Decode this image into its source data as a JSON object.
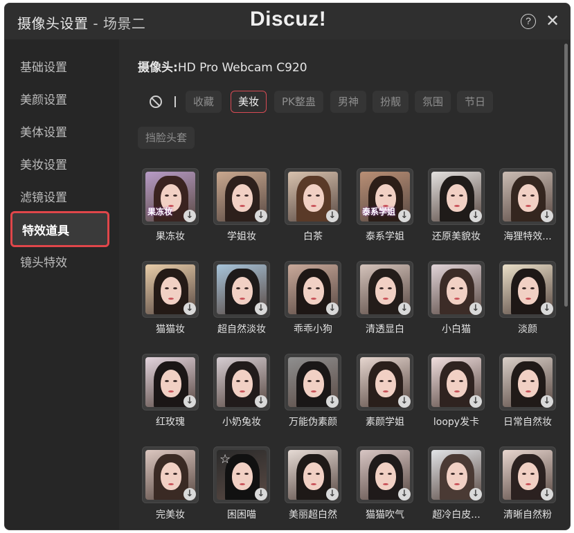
{
  "window": {
    "title": "摄像头设置",
    "scene": " - 场景二",
    "watermark": "Discuz!",
    "help_icon": "?",
    "close_icon": "✕"
  },
  "sidebar": {
    "items": [
      {
        "label": "基础设置"
      },
      {
        "label": "美颜设置"
      },
      {
        "label": "美体设置"
      },
      {
        "label": "美妆设置"
      },
      {
        "label": "滤镜设置"
      },
      {
        "label": "特效道具",
        "active": true
      },
      {
        "label": "镜头特效"
      }
    ]
  },
  "camera": {
    "label": "摄像头:",
    "name": "HD Pro Webcam C920"
  },
  "tabs": [
    {
      "label": "收藏"
    },
    {
      "label": "美妆",
      "active": true
    },
    {
      "label": "PK整蛊"
    },
    {
      "label": "男神"
    },
    {
      "label": "扮靓"
    },
    {
      "label": "氛围"
    },
    {
      "label": "节日"
    },
    {
      "label": "挡脸头套"
    }
  ],
  "colors": {
    "accent": "#e0464a",
    "panel": "#2b2b2b",
    "sidebar": "#262626"
  },
  "effects": [
    {
      "name": "果冻妆",
      "badge": "果冻妆",
      "bg": "#b89cc7",
      "hair": "#3a2320"
    },
    {
      "name": "学姐妆",
      "badge": "",
      "bg": "#c9a88f",
      "hair": "#2d201c"
    },
    {
      "name": "白茶",
      "badge": "",
      "bg": "#d8c2ae",
      "hair": "#5a3a28"
    },
    {
      "name": "泰系学姐",
      "badge": "泰系学姐",
      "bg": "#b98f75",
      "hair": "#2c1e18"
    },
    {
      "name": "还原美貌妆",
      "badge": "",
      "bg": "#e4e2e0",
      "hair": "#1f1b19"
    },
    {
      "name": "海狸特效...",
      "badge": "",
      "bg": "#cbbdb4",
      "hair": "#34261f"
    },
    {
      "name": "猫猫妆",
      "badge": "",
      "bg": "#e8cda9",
      "hair": "#241a16"
    },
    {
      "name": "超自然淡妆",
      "badge": "",
      "bg": "#a7c4da",
      "hair": "#1d1a1a"
    },
    {
      "name": "乖乖小狗",
      "badge": "",
      "bg": "#c9a99a",
      "hair": "#1e1715"
    },
    {
      "name": "清透显白",
      "badge": "",
      "bg": "#d4c3bb",
      "hair": "#241d1a"
    },
    {
      "name": "小白猫",
      "badge": "",
      "bg": "#e1d4d8",
      "hair": "#3c2c27"
    },
    {
      "name": "淡颜",
      "badge": "",
      "bg": "#eadfc8",
      "hair": "#1e1816"
    },
    {
      "name": "红玫瑰",
      "badge": "",
      "bg": "#e3d4dd",
      "hair": "#1b1616"
    },
    {
      "name": "小奶兔妆",
      "badge": "",
      "bg": "#d6cdd2",
      "hair": "#211b1b"
    },
    {
      "name": "万能伪素颜",
      "badge": "",
      "bg": "#8f8f8f",
      "hair": "#1a1717"
    },
    {
      "name": "素颜学姐",
      "badge": "",
      "bg": "#e6d6cf",
      "hair": "#2a1f1b"
    },
    {
      "name": "loopy发卡",
      "badge": "",
      "bg": "#f0dede",
      "hair": "#2f2320"
    },
    {
      "name": "日常自然妆",
      "badge": "",
      "bg": "#d9cfc8",
      "hair": "#201a18"
    },
    {
      "name": "完美妆",
      "badge": "",
      "bg": "#dcc7c0",
      "hair": "#3a2a24"
    },
    {
      "name": "困困喵",
      "badge": "",
      "bg": "#2a2a2a",
      "hair": "#111111",
      "star": true
    },
    {
      "name": "美丽超白然",
      "badge": "",
      "bg": "#e6dbd5",
      "hair": "#1e1917"
    },
    {
      "name": "猫猫吹气",
      "badge": "",
      "bg": "#d8c6c4",
      "hair": "#1f1a1a"
    },
    {
      "name": "超冷白皮...",
      "badge": "",
      "bg": "#e2e4e7",
      "hair": "#4a3a34"
    },
    {
      "name": "清晰自然粉",
      "badge": "",
      "bg": "#e8d6cf",
      "hair": "#2b2120"
    }
  ]
}
